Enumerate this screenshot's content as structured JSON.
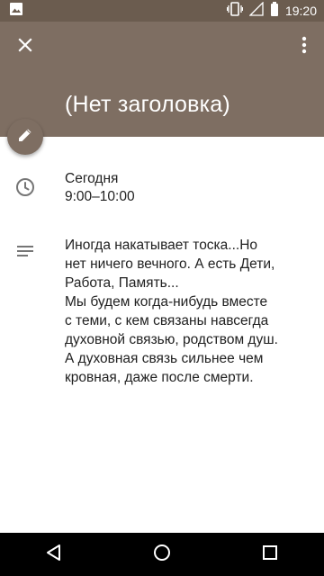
{
  "status_bar": {
    "time": "19:20",
    "icons": [
      "image-notification-icon",
      "vibrate-icon",
      "signal-icon",
      "battery-icon"
    ]
  },
  "header": {
    "title": "(Нет заголовка)",
    "icons": [
      "close-icon",
      "more-vert-icon"
    ]
  },
  "fab": {
    "icon": "pencil-edit-icon"
  },
  "event": {
    "date": "Сегодня",
    "time_range": "9:00–10:00",
    "description": "Иногда накатывает тоска...Но\nнет ничего вечного. А есть Дети,\nРабота, Память...\nМы будем когда-нибудь вместе\nс теми, с кем связаны навсегда\nдуховной связью, родством душ.\nА духовная связь сильнее чем\nкровная, даже после смерти."
  },
  "nav_bar": {
    "icons": [
      "back-icon",
      "home-icon",
      "recents-icon"
    ]
  },
  "colors": {
    "header": "#7e6e62",
    "status_bar": "#6b5c4f",
    "text": "#212121",
    "icon_gray": "#757575"
  }
}
